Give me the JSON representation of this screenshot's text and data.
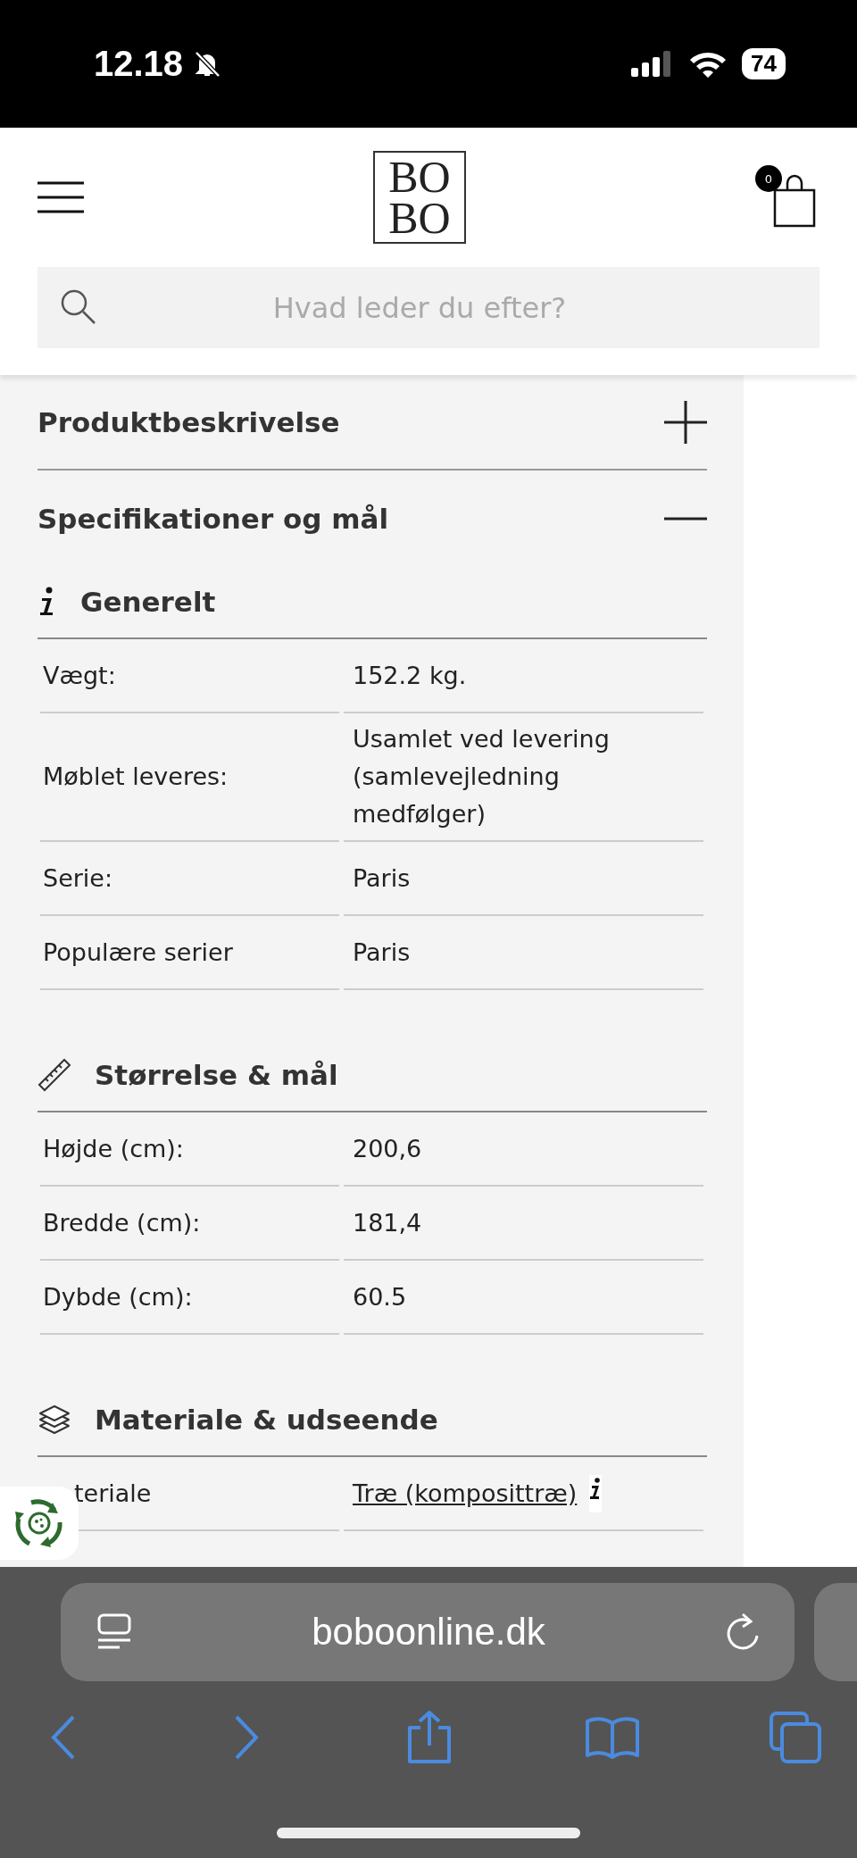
{
  "status_bar": {
    "time": "12.18",
    "battery": "74"
  },
  "header": {
    "logo": [
      "BO",
      "BO"
    ],
    "cart_count": "0",
    "search": {
      "placeholder": "Hvad leder du efter?"
    }
  },
  "accordions": [
    {
      "title": "Produktbeskrivelse",
      "expanded": false
    },
    {
      "title": "Specifikationer og mål",
      "expanded": true
    }
  ],
  "sections": [
    {
      "title": "Generelt",
      "kind": "info",
      "rows": [
        {
          "label": "Vægt:",
          "value": "152.2 kg.",
          "linked": false
        },
        {
          "label": "Møblet leveres:",
          "value": "Usamlet ved levering (samlevejledning medfølger)",
          "linked": false
        },
        {
          "label": "Serie:",
          "value": "Paris",
          "linked": false
        },
        {
          "label": "Populære serier",
          "value": "Paris",
          "linked": false
        }
      ]
    },
    {
      "title": "Størrelse & mål",
      "kind": "ruler",
      "rows": [
        {
          "label": "Højde (cm):",
          "value": "200,6",
          "linked": false
        },
        {
          "label": "Bredde (cm):",
          "value": "181,4",
          "linked": false
        },
        {
          "label": "Dybde (cm):",
          "value": "60.5",
          "linked": false
        }
      ]
    },
    {
      "title": "Materiale & udseende",
      "kind": "layers",
      "rows": [
        {
          "label": "teriale",
          "value": "Træ (komposittræ)",
          "linked": true
        }
      ]
    }
  ],
  "browser": {
    "url": "boboonline.dk"
  }
}
